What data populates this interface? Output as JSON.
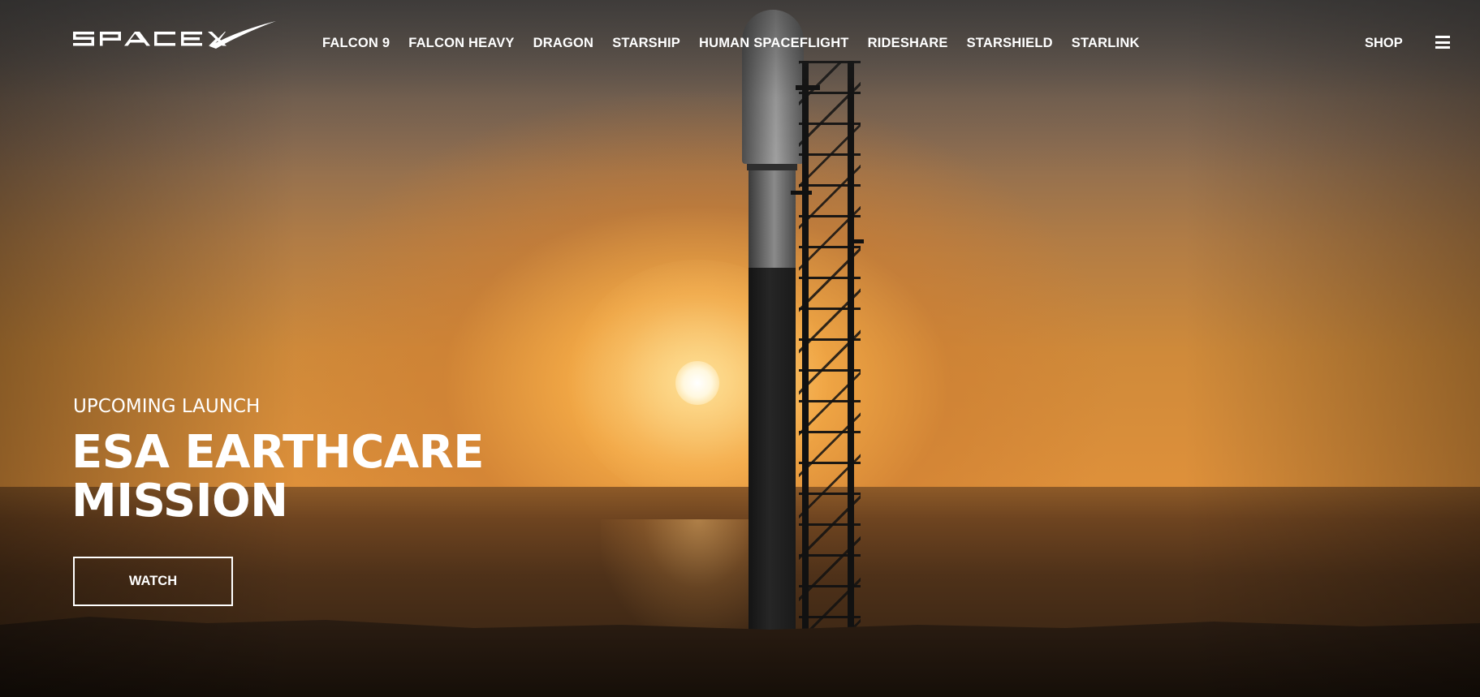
{
  "brand": {
    "logo_text": "SPACEX",
    "logo_icon": "spacex-logo"
  },
  "nav": {
    "items": [
      {
        "label": "FALCON 9"
      },
      {
        "label": "FALCON HEAVY"
      },
      {
        "label": "DRAGON"
      },
      {
        "label": "STARSHIP"
      },
      {
        "label": "HUMAN SPACEFLIGHT"
      },
      {
        "label": "RIDESHARE"
      },
      {
        "label": "STARSHIELD"
      },
      {
        "label": "STARLINK"
      }
    ],
    "shop_label": "SHOP",
    "menu_icon": "hamburger-menu-icon"
  },
  "hero": {
    "eyebrow": "UPCOMING LAUNCH",
    "headline_line1": "ESA EARTHCARE",
    "headline_line2": "MISSION",
    "cta_label": "WATCH"
  },
  "colors": {
    "text": "#ffffff",
    "sky_top": "#5a5450",
    "sky_horizon": "#e0913a",
    "sea": "#4e3119"
  }
}
